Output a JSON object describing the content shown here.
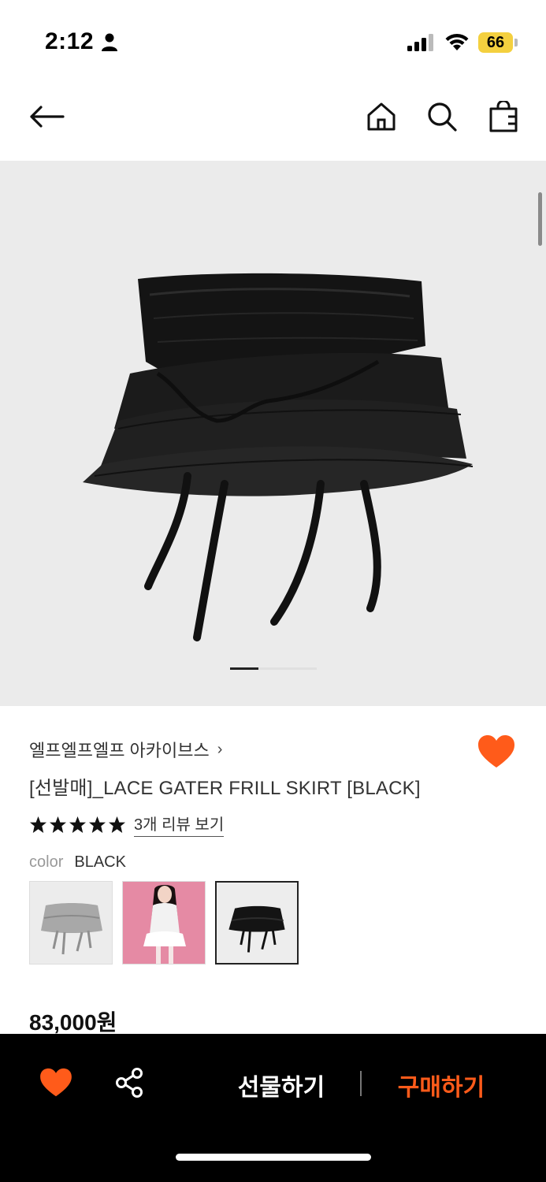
{
  "status_bar": {
    "time": "2:12",
    "battery": "66"
  },
  "product": {
    "brand": "엘프엘프엘프 아카이브스",
    "name": "[선발매]_LACE GATER FRILL SKIRT [BLACK]",
    "rating": 5,
    "review_link": "3개 리뷰 보기",
    "color_label": "color",
    "color_value": "BLACK",
    "swatches": [
      {
        "color": "gray",
        "selected": false
      },
      {
        "color": "model",
        "selected": false
      },
      {
        "color": "black",
        "selected": true
      }
    ],
    "price": "83,000원"
  },
  "gallery": {
    "current": 1
  },
  "bottom_bar": {
    "gift_label": "선물하기",
    "buy_label": "구매하기"
  },
  "colors": {
    "accent": "#ff5b1a",
    "bar_bg": "#000000",
    "hero_bg": "#ebebeb"
  }
}
